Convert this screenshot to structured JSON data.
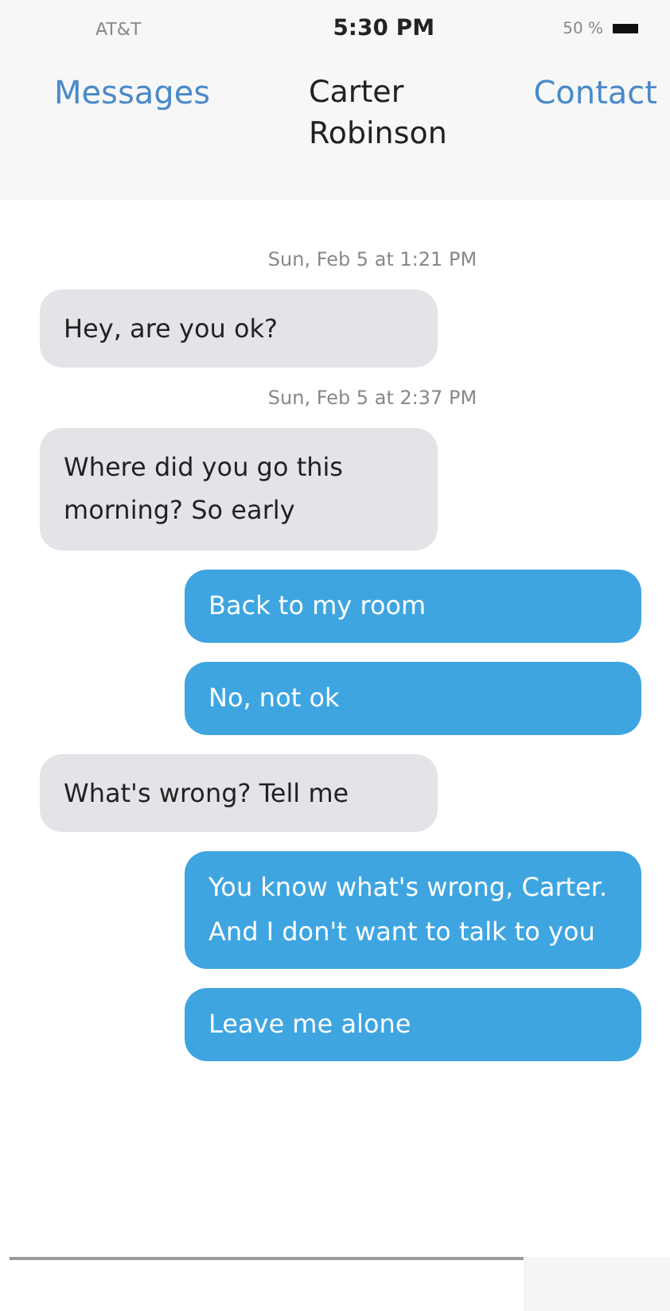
{
  "status_bar": {
    "carrier": "AT&T",
    "time": "5:30 PM",
    "battery": "50 %"
  },
  "nav": {
    "back": "Messages",
    "title": "Carter Robinson",
    "action": "Contact"
  },
  "thread": [
    {
      "kind": "timestamp",
      "text": "Sun, Feb 5 at 1:21 PM"
    },
    {
      "kind": "incoming",
      "text": "Hey, are you ok?"
    },
    {
      "kind": "timestamp",
      "text": "Sun, Feb 5 at 2:37 PM"
    },
    {
      "kind": "incoming",
      "text": "Where did you go this morning? So early"
    },
    {
      "kind": "outgoing",
      "text": "Back to my room"
    },
    {
      "kind": "outgoing",
      "text": "No, not ok"
    },
    {
      "kind": "incoming",
      "text": "What's wrong? Tell me"
    },
    {
      "kind": "outgoing",
      "text": "You know what's wrong, Carter. And I don't want to talk to you"
    },
    {
      "kind": "outgoing",
      "text": "Leave me alone"
    }
  ]
}
